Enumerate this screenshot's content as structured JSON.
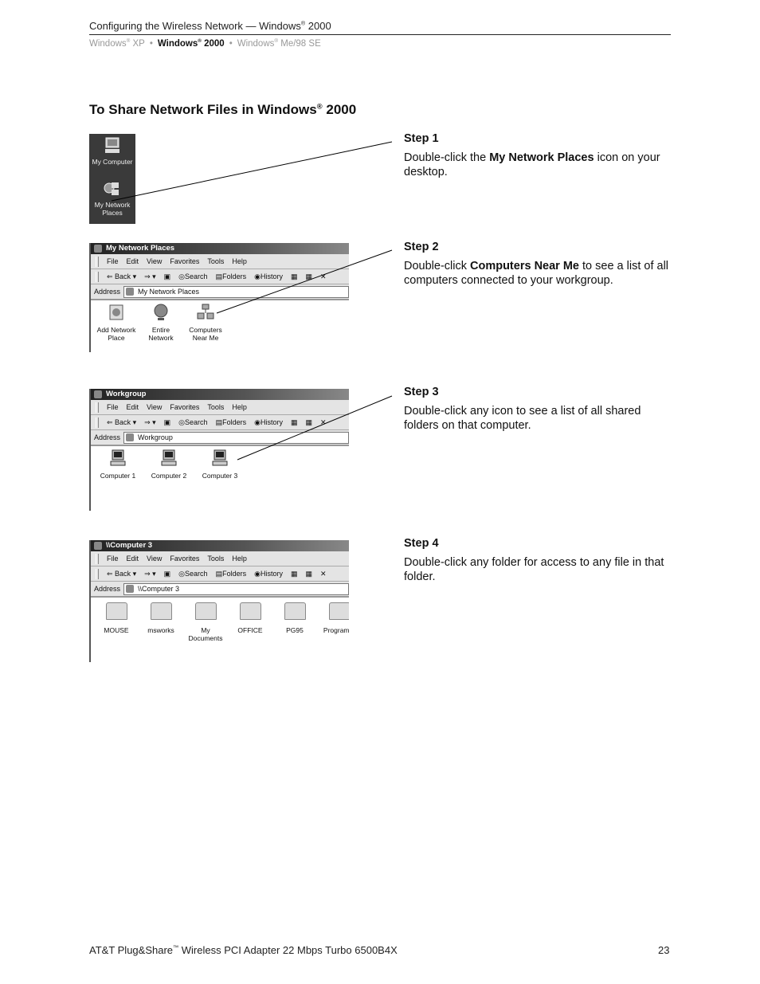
{
  "header": {
    "title_pre": "Configuring the Wireless Network — Windows",
    "title_sup": "®",
    "title_post": " 2000",
    "nav": [
      {
        "label": "Windows",
        "sup": "®",
        "suffix": " XP",
        "current": false
      },
      {
        "label": "Windows",
        "sup": "®",
        "suffix": " 2000",
        "current": true
      },
      {
        "label": "Windows",
        "sup": "®",
        "suffix": " Me/98 SE",
        "current": false
      }
    ],
    "separator": "•"
  },
  "section": {
    "title_pre": "To Share Network Files in Windows",
    "title_sup": "®",
    "title_post": " 2000"
  },
  "desktop": {
    "icons": [
      {
        "name": "My Computer",
        "icon": "computer-icon"
      },
      {
        "name": "My Network Places",
        "icon": "network-places-icon"
      }
    ]
  },
  "explorer": {
    "menu": [
      "File",
      "Edit",
      "View",
      "Favorites",
      "Tools",
      "Help"
    ],
    "toolbar": {
      "back": "Back",
      "search": "Search",
      "folders": "Folders",
      "history": "History"
    },
    "address_label": "Address"
  },
  "windows": [
    {
      "title": "My Network Places",
      "address": "My Network Places",
      "items": [
        {
          "line1": "Add Network",
          "line2": "Place",
          "icon": "add-network-place-icon"
        },
        {
          "line1": "Entire",
          "line2": "Network",
          "icon": "globe-icon"
        },
        {
          "line1": "Computers",
          "line2": "Near Me",
          "icon": "computers-near-me-icon"
        }
      ]
    },
    {
      "title": "Workgroup",
      "address": "Workgroup",
      "items": [
        {
          "line1": "Computer 1",
          "line2": "",
          "icon": "computer-icon"
        },
        {
          "line1": "Computer 2",
          "line2": "",
          "icon": "computer-icon"
        },
        {
          "line1": "Computer 3",
          "line2": "",
          "icon": "computer-icon"
        }
      ]
    },
    {
      "title": "\\\\Computer 3",
      "address": "\\\\Computer 3",
      "items": [
        {
          "line1": "MOUSE",
          "line2": "",
          "icon": "folder-icon"
        },
        {
          "line1": "msworks",
          "line2": "",
          "icon": "folder-icon"
        },
        {
          "line1": "My",
          "line2": "Documents",
          "icon": "folder-icon"
        },
        {
          "line1": "OFFICE",
          "line2": "",
          "icon": "folder-icon"
        },
        {
          "line1": "PG95",
          "line2": "",
          "icon": "folder-icon"
        },
        {
          "line1": "Program F",
          "line2": "",
          "icon": "folder-icon"
        }
      ]
    }
  ],
  "steps": [
    {
      "label": "Step 1",
      "pre": "Double-click the ",
      "bold": "My Network Places",
      "post": " icon on your desktop."
    },
    {
      "label": "Step 2",
      "pre": "Double-click ",
      "bold": "Computers Near Me",
      "post": " to see a list of all computers connected to your workgroup."
    },
    {
      "label": "Step 3",
      "pre": "Double-click any icon to see a list of all shared folders on that computer.",
      "bold": "",
      "post": ""
    },
    {
      "label": "Step 4",
      "pre": "Double-click any folder for access to any file in that folder.",
      "bold": "",
      "post": ""
    }
  ],
  "footer": {
    "pre": "AT&T Plug&Share",
    "sup": "™",
    "post": " Wireless PCI Adapter 22 Mbps Turbo 6500B4X",
    "page": "23"
  }
}
